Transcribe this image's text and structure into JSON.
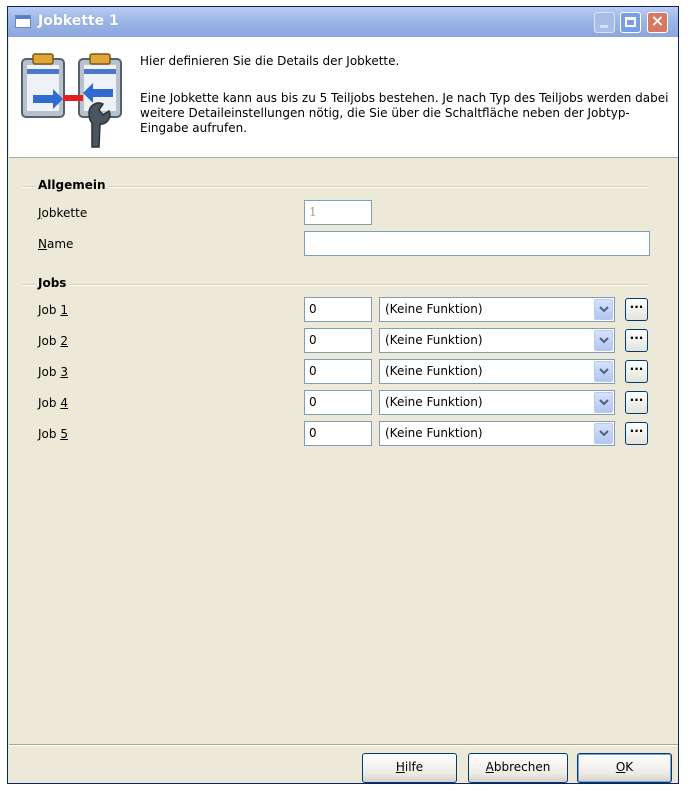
{
  "window": {
    "title": "Jobkette 1"
  },
  "header": {
    "line1": "Hier definieren Sie die Details der Jobkette.",
    "paragraph": "Eine Jobkette kann aus bis zu 5 Teiljobs bestehen. Je nach Typ des Teiljobs werden dabei weitere Detaileinstellungen nötig, die Sie über die Schaltfläche neben der Jobtyp-Eingabe aufrufen.",
    "icon": "job-chain-icon"
  },
  "general": {
    "title": "Allgemein",
    "jobkette_label_u": "J",
    "jobkette_label_rest": "obkette",
    "jobkette_value": "1",
    "name_label_u": "N",
    "name_label_rest": "ame",
    "name_value": ""
  },
  "jobs": {
    "title": "Jobs",
    "rows": [
      {
        "label_prefix": "Job ",
        "label_key": "1",
        "number": "0",
        "function": "(Keine Funktion)"
      },
      {
        "label_prefix": "Job ",
        "label_key": "2",
        "number": "0",
        "function": "(Keine Funktion)"
      },
      {
        "label_prefix": "Job ",
        "label_key": "3",
        "number": "0",
        "function": "(Keine Funktion)"
      },
      {
        "label_prefix": "Job ",
        "label_key": "4",
        "number": "0",
        "function": "(Keine Funktion)"
      },
      {
        "label_prefix": "Job ",
        "label_key": "5",
        "number": "0",
        "function": "(Keine Funktion)"
      }
    ],
    "details_label": "···"
  },
  "buttons": {
    "help_u": "H",
    "help_rest": "ilfe",
    "cancel_u": "A",
    "cancel_rest": "bbrechen",
    "ok_u": "O",
    "ok_rest": "K"
  }
}
